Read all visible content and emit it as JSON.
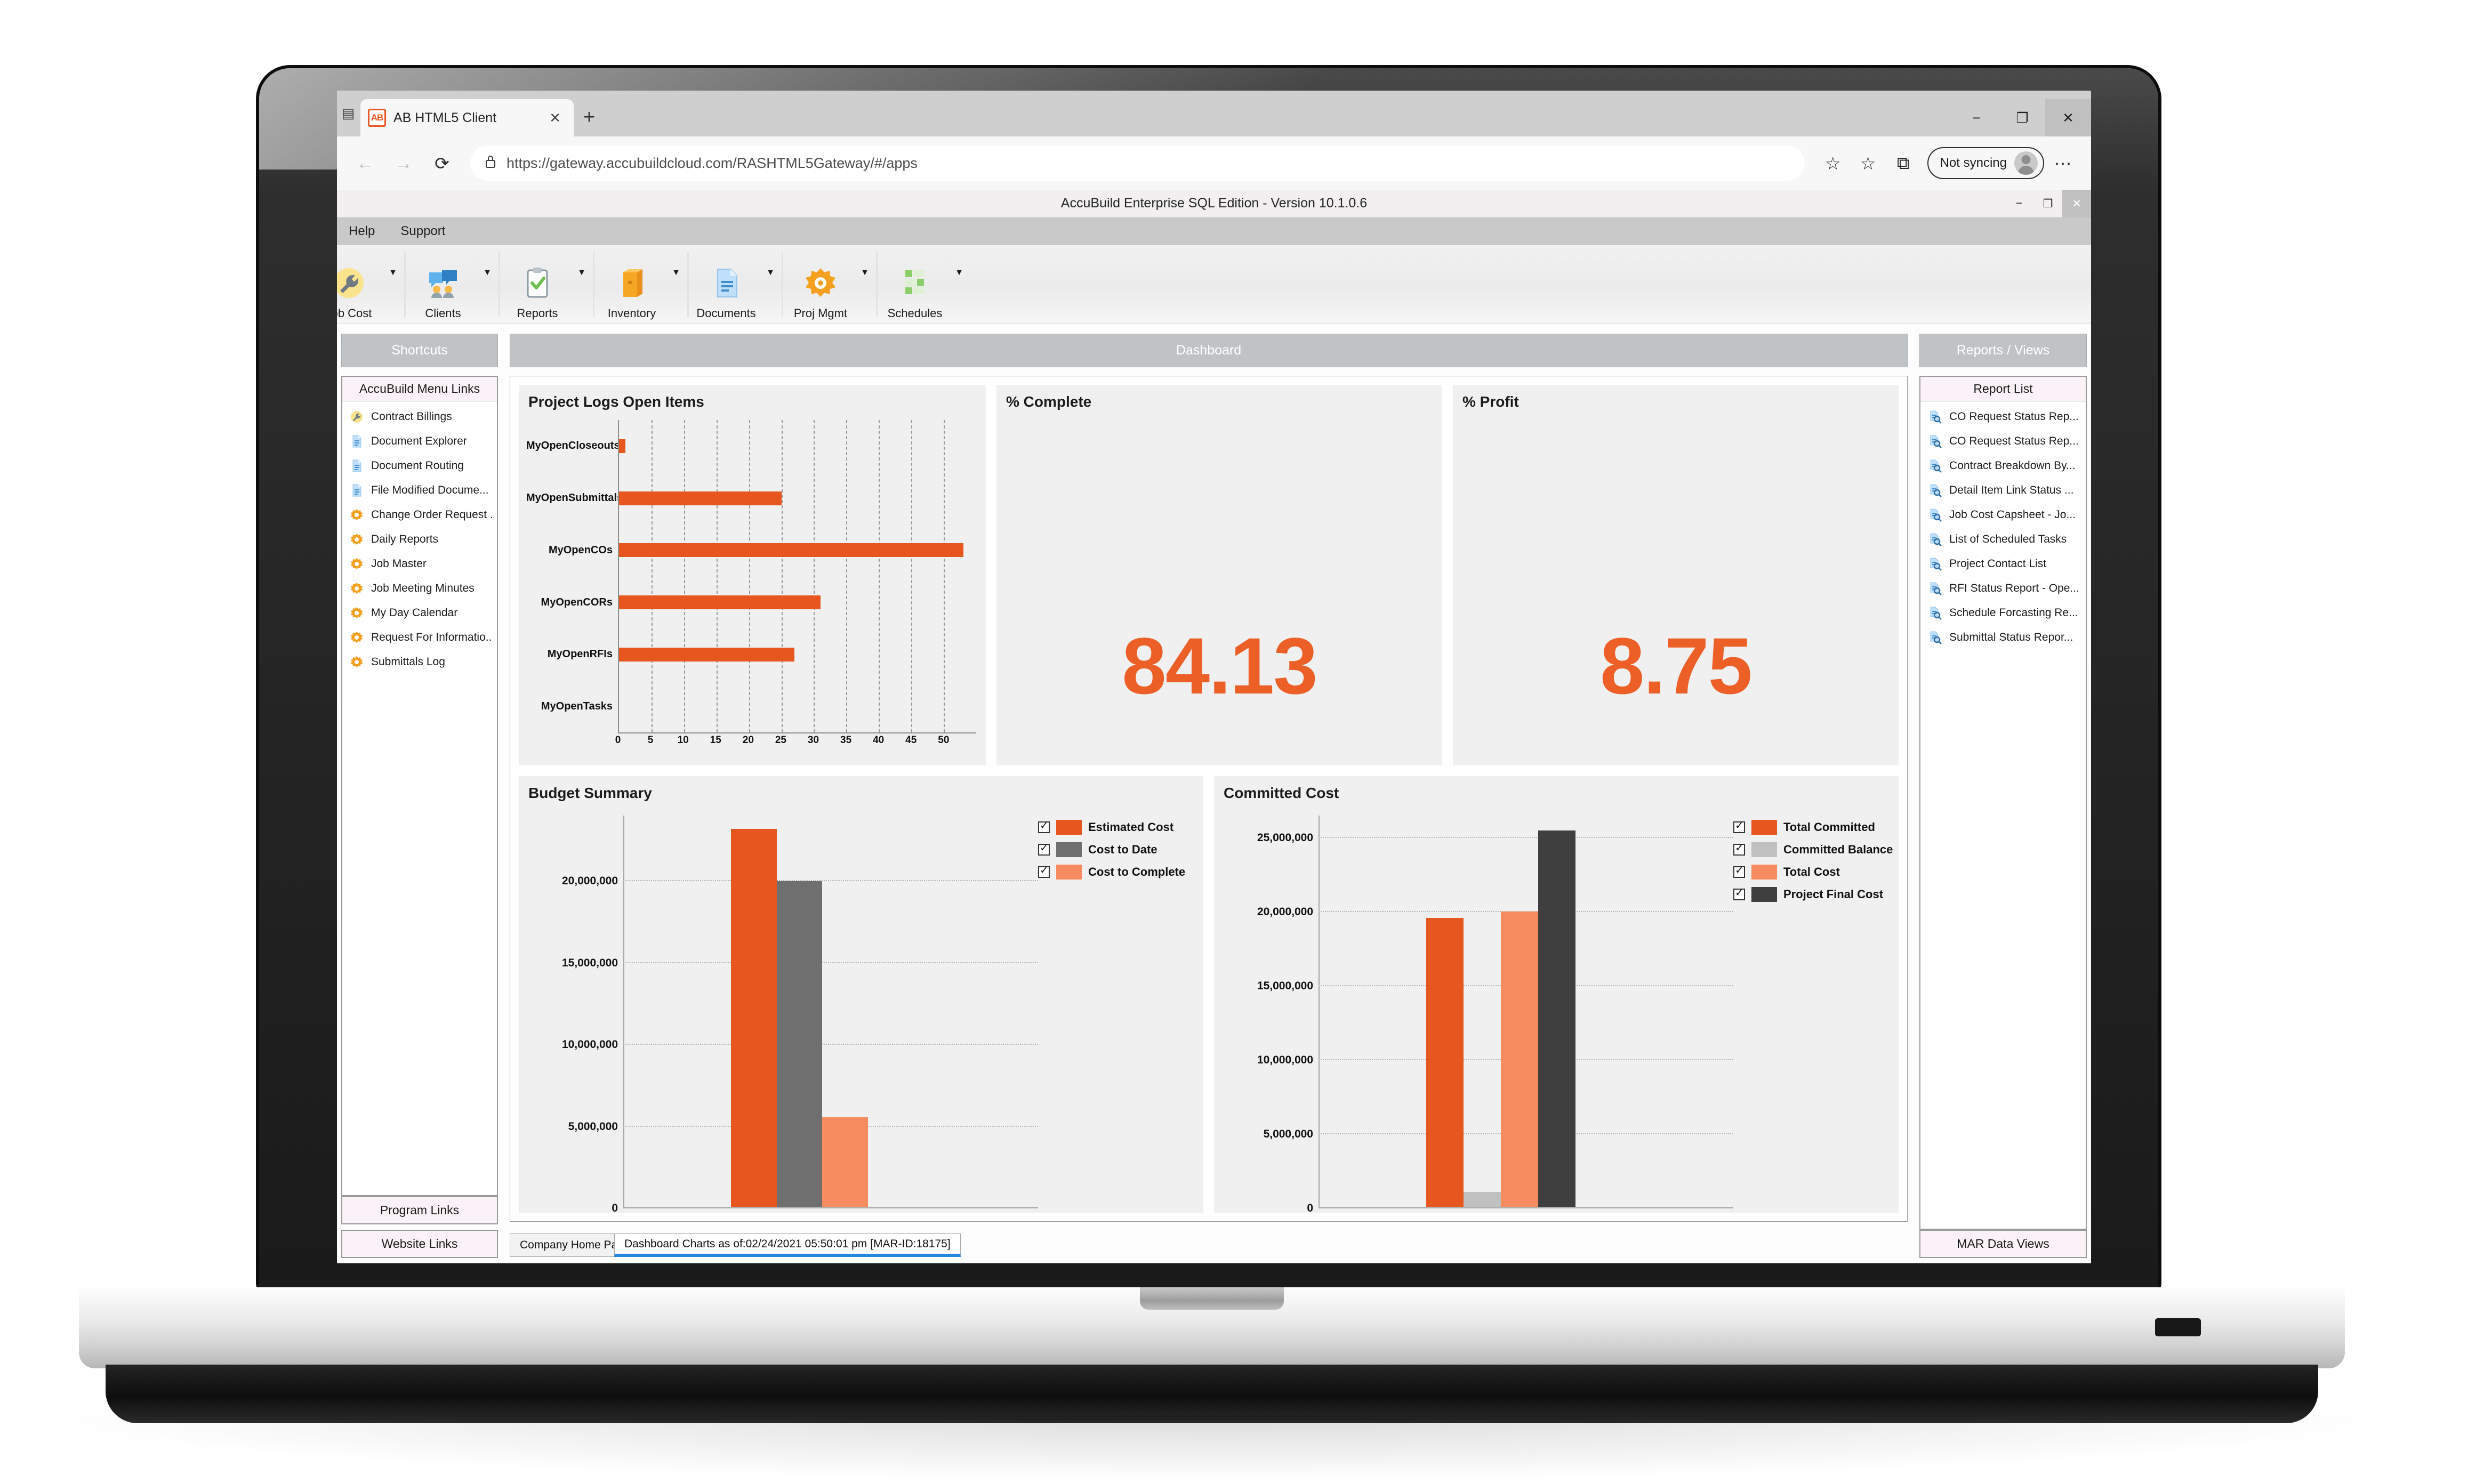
{
  "browser": {
    "tab_title": "AB HTML5 Client",
    "favicon_text": "AB",
    "close_tab": "✕",
    "new_tab": "+",
    "back_icon": "←",
    "forward_icon": "→",
    "reload_icon": "⟳",
    "lock_icon": "🔒",
    "url": "https://gateway.accubuildcloud.com/RASHTML5Gateway/#/apps",
    "favorite_icon": "☆",
    "collections_icon": "☆",
    "splitscreen_icon": "⧉",
    "profile_label": "Not syncing",
    "more_icon": "⋯",
    "window_minimize": "−",
    "window_maximize": "❐",
    "window_close": "✕"
  },
  "app": {
    "title": "AccuBuild Enterprise SQL Edition - Version 10.1.0.6",
    "window_minimize": "−",
    "window_restore": "❐",
    "window_close": "✕",
    "menu": [
      "Help",
      "Support"
    ],
    "ribbon": [
      {
        "label": "Job Cost",
        "icon": "wrench-icon"
      },
      {
        "label": "Clients",
        "icon": "clients-icon"
      },
      {
        "label": "Reports",
        "icon": "clipboard-check-icon"
      },
      {
        "label": "Inventory",
        "icon": "box-icon"
      },
      {
        "label": "Documents",
        "icon": "document-icon"
      },
      {
        "label": "Proj Mgmt",
        "icon": "gear-icon"
      },
      {
        "label": "Schedules",
        "icon": "schedule-icon"
      }
    ],
    "ribbon_caret": "▼"
  },
  "sidebar_left": {
    "header": "Shortcuts",
    "list_title": "AccuBuild Menu Links",
    "items": [
      {
        "label": "Contract Billings",
        "icon": "wrench-icon"
      },
      {
        "label": "Document Explorer",
        "icon": "document-icon"
      },
      {
        "label": "Document Routing",
        "icon": "document-icon"
      },
      {
        "label": "File Modified Docume...",
        "icon": "document-icon"
      },
      {
        "label": "Change Order Request ...",
        "icon": "gear-icon"
      },
      {
        "label": "Daily Reports",
        "icon": "gear-icon"
      },
      {
        "label": "Job Master",
        "icon": "gear-icon"
      },
      {
        "label": "Job Meeting Minutes",
        "icon": "gear-icon"
      },
      {
        "label": "My Day Calendar",
        "icon": "gear-icon"
      },
      {
        "label": "Request For Informatio...",
        "icon": "gear-icon"
      },
      {
        "label": "Submittals Log",
        "icon": "gear-icon"
      }
    ],
    "footer_buttons": [
      "Program Links",
      "Website Links"
    ]
  },
  "sidebar_right": {
    "header": "Reports / Views",
    "list_title": "Report List",
    "items": [
      {
        "label": "CO Request Status Rep...",
        "icon": "report-search-icon"
      },
      {
        "label": "CO Request Status Rep...",
        "icon": "report-search-icon"
      },
      {
        "label": "Contract Breakdown By...",
        "icon": "report-search-icon"
      },
      {
        "label": "Detail Item Link Status ...",
        "icon": "report-search-icon"
      },
      {
        "label": "Job Cost Capsheet - Jo...",
        "icon": "report-search-icon"
      },
      {
        "label": "List of Scheduled Tasks",
        "icon": "report-search-icon"
      },
      {
        "label": "Project Contact List",
        "icon": "report-search-icon"
      },
      {
        "label": "RFI Status Report - Ope...",
        "icon": "report-search-icon"
      },
      {
        "label": "Schedule Forcasting Re...",
        "icon": "report-search-icon"
      },
      {
        "label": "Submittal Status Repor...",
        "icon": "report-search-icon"
      }
    ],
    "footer_buttons": [
      "MAR Data Views"
    ]
  },
  "dashboard": {
    "header": "Dashboard",
    "kpi_complete": {
      "title": "% Complete",
      "value": "84.13"
    },
    "kpi_profit": {
      "title": "% Profit",
      "value": "8.75"
    }
  },
  "statusbar": {
    "tabs": [
      {
        "label": "Company Home Page",
        "active": false
      },
      {
        "label": "Dashboard Charts as of:02/24/2021 05:50:01 pm [MAR-ID:18175]",
        "active": true
      }
    ]
  },
  "colors": {
    "accent_orange": "#e8561f",
    "kpi_orange": "#ec5f27",
    "gray_bar": "#6f6f6f",
    "light_orange": "#f58b5e",
    "light_gray": "#c0c0c0",
    "dark_gray": "#3f3f3f",
    "panel_header": "#bfc3c6",
    "card_bg": "#eff0ef",
    "tab_active_underline": "#1f8ae0"
  },
  "chart_data": [
    {
      "type": "bar",
      "orientation": "horizontal",
      "title": "Project Logs Open Items",
      "categories": [
        "MyOpenCloseouts",
        "MyOpenSubmittals",
        "MyOpenCOs",
        "MyOpenCORs",
        "MyOpenRFIs",
        "MyOpenTasks"
      ],
      "values": [
        1,
        25,
        53,
        31,
        27,
        0
      ],
      "xlabel": "",
      "ylabel": "",
      "xlim": [
        0,
        55
      ],
      "xticks": [
        0,
        5,
        10,
        15,
        20,
        25,
        30,
        35,
        40,
        45,
        50
      ],
      "grid": true,
      "legend": "none",
      "series_color": "#e8561f"
    },
    {
      "type": "bar",
      "orientation": "vertical",
      "title": "Budget Summary",
      "categories": [
        ""
      ],
      "series": [
        {
          "name": "Estimated Cost",
          "values": [
            23200000
          ],
          "color": "#e8561f"
        },
        {
          "name": "Cost to Date",
          "values": [
            20000000
          ],
          "color": "#6f6f6f"
        },
        {
          "name": "Cost to Complete",
          "values": [
            5500000
          ],
          "color": "#f58b5e"
        }
      ],
      "ylim": [
        0,
        24000000
      ],
      "yticks": [
        0,
        5000000,
        10000000,
        15000000,
        20000000
      ],
      "ytick_labels": [
        "0",
        "5,000,000",
        "10,000,000",
        "15,000,000",
        "20,000,000"
      ],
      "grid": true,
      "legend": "right",
      "legend_checkboxes": true
    },
    {
      "type": "bar",
      "orientation": "vertical",
      "title": "Committed Cost",
      "categories": [
        ""
      ],
      "series": [
        {
          "name": "Total Committed",
          "values": [
            19600000
          ],
          "color": "#e8561f"
        },
        {
          "name": "Committed Balance",
          "values": [
            1000000
          ],
          "color": "#c0c0c0"
        },
        {
          "name": "Total Cost",
          "values": [
            20000000
          ],
          "color": "#f58b5e"
        },
        {
          "name": "Project Final Cost",
          "values": [
            25500000
          ],
          "color": "#3f3f3f"
        }
      ],
      "ylim": [
        0,
        26500000
      ],
      "yticks": [
        0,
        5000000,
        10000000,
        15000000,
        20000000,
        25000000
      ],
      "ytick_labels": [
        "0",
        "5,000,000",
        "10,000,000",
        "15,000,000",
        "20,000,000",
        "25,000,000"
      ],
      "grid": true,
      "legend": "right",
      "legend_checkboxes": true
    }
  ]
}
